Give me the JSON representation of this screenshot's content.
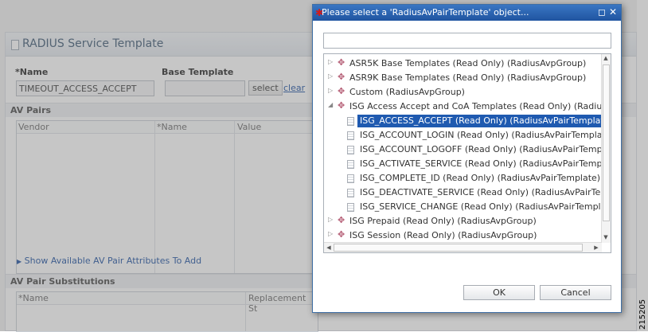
{
  "form": {
    "title": "RADIUS Service Template",
    "name_label": "*Name",
    "name_value": "TIMEOUT_ACCESS_ACCEPT",
    "base_template_label": "Base Template",
    "base_template_value": "",
    "select_label": "select",
    "clear_label": "clear",
    "av_pairs_header": "AV Pairs",
    "av_pairs_columns": [
      "Vendor",
      "*Name",
      "Value"
    ],
    "show_attrs_label": "Show Available AV Pair Attributes To Add",
    "av_subs_header": "AV Pair Substitutions",
    "av_subs_columns": [
      "*Name",
      "Replacement St"
    ]
  },
  "dialog": {
    "title": "Please select a 'RadiusAvPairTemplate' object...",
    "filter_value": "",
    "tree": [
      {
        "label": "ASR5K Base Templates (Read Only) (RadiusAvpGroup)",
        "type": "group",
        "expanded": false
      },
      {
        "label": "ASR9K Base Templates (Read Only) (RadiusAvpGroup)",
        "type": "group",
        "expanded": false
      },
      {
        "label": "Custom (RadiusAvpGroup)",
        "type": "group",
        "expanded": false
      },
      {
        "label": "ISG Access Accept and CoA Templates (Read Only) (RadiusAv",
        "type": "group",
        "expanded": true
      },
      {
        "label": "ISG_ACCESS_ACCEPT (Read Only) (RadiusAvPairTemplate)",
        "type": "leaf",
        "selected": true
      },
      {
        "label": "ISG_ACCOUNT_LOGIN (Read Only) (RadiusAvPairTemplate)",
        "type": "leaf"
      },
      {
        "label": "ISG_ACCOUNT_LOGOFF (Read Only) (RadiusAvPairTemplat",
        "type": "leaf"
      },
      {
        "label": "ISG_ACTIVATE_SERVICE (Read Only) (RadiusAvPairTemplat",
        "type": "leaf"
      },
      {
        "label": "ISG_COMPLETE_ID (Read Only) (RadiusAvPairTemplate)",
        "type": "leaf"
      },
      {
        "label": "ISG_DEACTIVATE_SERVICE (Read Only) (RadiusAvPairTemp",
        "type": "leaf"
      },
      {
        "label": "ISG_SERVICE_CHANGE (Read Only) (RadiusAvPairTemplate",
        "type": "leaf"
      },
      {
        "label": "ISG Prepaid (Read Only) (RadiusAvpGroup)",
        "type": "group",
        "expanded": false
      },
      {
        "label": "ISG Session (Read Only) (RadiusAvpGroup)",
        "type": "group",
        "expanded": false
      }
    ],
    "ok_label": "OK",
    "cancel_label": "Cancel"
  },
  "figure_number": "215205",
  "icons": {
    "group": "group-icon",
    "leaf": "template-icon",
    "maximize": "maximize-icon",
    "close": "close-icon",
    "expand": "expand-arrow-icon"
  },
  "colors": {
    "title_bar": "#1f54a0",
    "selection": "#1f5ab0",
    "group_icon": "#b45b73",
    "link": "#1a4fa0"
  }
}
